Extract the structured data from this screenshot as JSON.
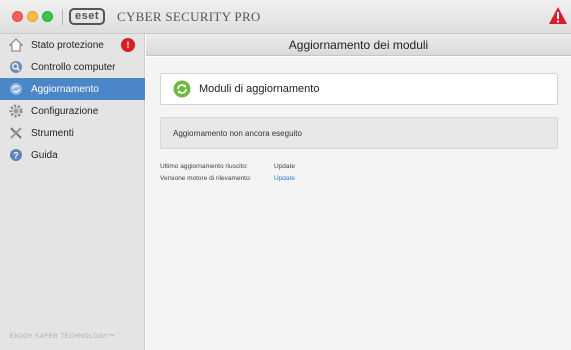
{
  "app": {
    "logo_text": "eset",
    "title": "CYBER SECURITY PRO"
  },
  "sidebar": {
    "items": [
      {
        "label": "Stato protezione",
        "icon": "home-icon",
        "badge": "!"
      },
      {
        "label": "Controllo computer",
        "icon": "scan-icon"
      },
      {
        "label": "Aggiornamento",
        "icon": "update-icon",
        "active": true
      },
      {
        "label": "Configurazione",
        "icon": "gear-icon"
      },
      {
        "label": "Strumenti",
        "icon": "tools-icon"
      },
      {
        "label": "Guida",
        "icon": "help-icon"
      }
    ],
    "footer": "ENJOY SAFER TECHNOLOGY™"
  },
  "main": {
    "header": "Aggiornamento dei moduli",
    "card_label": "Moduli di aggiornamento",
    "status_text": "Aggiornamento non ancora eseguito",
    "info": [
      {
        "label": "Ultimo aggiornamento riuscito:",
        "value": "Update"
      },
      {
        "label": "Versione motore di rilevamento:",
        "value": "Update"
      }
    ]
  },
  "colors": {
    "accent": "#4a86c8",
    "badge": "#d81e2b",
    "link": "#2f7ac8",
    "refresh_green": "#6cbb3c",
    "warning_red": "#d81e2b"
  }
}
